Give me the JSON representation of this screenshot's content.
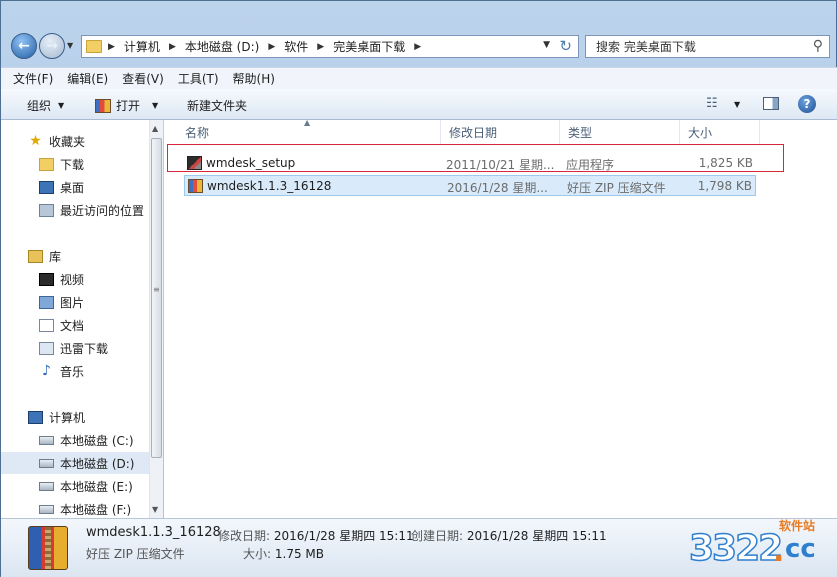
{
  "address": {
    "crumbs": [
      "计算机",
      "本地磁盘 (D:)",
      "软件",
      "完美桌面下载"
    ]
  },
  "search": {
    "placeholder": "搜索 完美桌面下载"
  },
  "menu": [
    "文件(F)",
    "编辑(E)",
    "查看(V)",
    "工具(T)",
    "帮助(H)"
  ],
  "toolbar": {
    "organize": "组织",
    "open": "打开",
    "new_folder": "新建文件夹"
  },
  "nav": {
    "favorites": "收藏夹",
    "downloads": "下载",
    "desktop": "桌面",
    "recent": "最近访问的位置",
    "libraries": "库",
    "videos": "视频",
    "pictures": "图片",
    "documents": "文档",
    "thunder": "迅雷下载",
    "music": "音乐",
    "computer": "计算机",
    "drive_c": "本地磁盘 (C:)",
    "drive_d": "本地磁盘 (D:)",
    "drive_e": "本地磁盘 (E:)",
    "drive_f": "本地磁盘 (F:)"
  },
  "columns": {
    "name": "名称",
    "modified": "修改日期",
    "type": "类型",
    "size": "大小"
  },
  "files": [
    {
      "name": "wmdesk_setup",
      "modified": "2011/10/21 星期...",
      "type": "应用程序",
      "size": "1,825 KB"
    },
    {
      "name": "wmdesk1.1.3_16128",
      "modified": "2016/1/28 星期...",
      "type": "好压 ZIP 压缩文件",
      "size": "1,798 KB"
    }
  ],
  "details": {
    "name": "wmdesk1.1.3_16128",
    "modified_label": "修改日期:",
    "modified_value": "2016/1/28 星期四 15:11",
    "created_label": "创建日期:",
    "created_value": "2016/1/28 星期四 15:11",
    "type": "好压 ZIP 压缩文件",
    "size_label": "大小:",
    "size_value": "1.75 MB"
  },
  "watermark": {
    "number": "3322",
    "dot": ".",
    "tld": "cc",
    "tag": "软件站"
  },
  "colors": {
    "highlight": "#d6283a",
    "selection": "#d9ebfb",
    "accent": "#2f7fcf"
  }
}
